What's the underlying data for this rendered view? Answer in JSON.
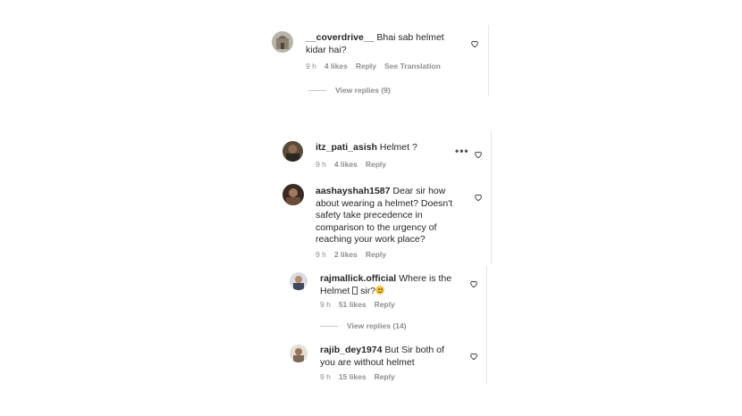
{
  "comments": [
    {
      "username": "__coverdrive__",
      "text": " Bhai sab helmet kidar hai?",
      "time": "9 h",
      "likes": "4 likes",
      "reply": "Reply",
      "translate": "See Translation",
      "view_replies": "View replies (9)"
    },
    {
      "username": "itz_pati_asish",
      "text": " Helmet ?",
      "time": "9 h",
      "likes": "4 likes",
      "reply": "Reply",
      "more": "•••"
    },
    {
      "username": "aashayshah1587",
      "text": " Dear sir how about wearing a helmet? Doesn't safety take precedence in comparison to the urgency of reaching your work place?",
      "time": "9 h",
      "likes": "2 likes",
      "reply": "Reply"
    },
    {
      "username": "rajmallick.official",
      "text_line1": " Where is the",
      "text_line2_a": "Helmet ",
      "text_line2_b": " sir?",
      "time": "9 h",
      "likes": "51 likes",
      "reply": "Reply",
      "view_replies": "View replies (14)"
    },
    {
      "username": "rajib_dey1974",
      "text": " But Sir both of you are without helmet",
      "time": "9 h",
      "likes": "15 likes",
      "reply": "Reply"
    }
  ],
  "icons": {
    "like": "heart-icon",
    "more": "more-options-icon"
  }
}
